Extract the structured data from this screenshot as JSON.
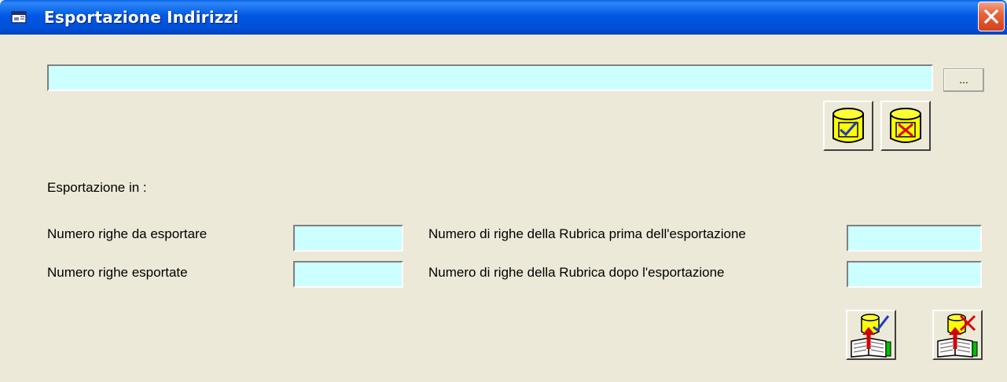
{
  "window": {
    "title": "Esportazione Indirizzi",
    "title_icon": "window-app-icon",
    "close_icon": "close-icon",
    "titlebar_color": "#0058E3",
    "close_color": "#E2552F"
  },
  "file_selector": {
    "path_value": "",
    "browse_label": "..."
  },
  "file_actions": {
    "confirm_icon": "database-check-icon",
    "cancel_icon": "database-cross-icon"
  },
  "export": {
    "heading": "Esportazione in :",
    "rows_to_export_label": "Numero righe da esportare",
    "rows_to_export_value": "",
    "rows_exported_label": "Numero righe esportate",
    "rows_exported_value": "",
    "rubrica_before_label": "Numero di righe della Rubrica prima dell'esportazione",
    "rubrica_before_value": "",
    "rubrica_after_label": "Numero di righe della Rubrica dopo l'esportazione",
    "rubrica_after_value": ""
  },
  "export_actions": {
    "start_icon": "export-to-addressbook-check-icon",
    "cancel_icon": "export-to-addressbook-cross-icon"
  },
  "colors": {
    "field_background": "#CCFFFF",
    "dialog_background": "#ECE9D8"
  }
}
